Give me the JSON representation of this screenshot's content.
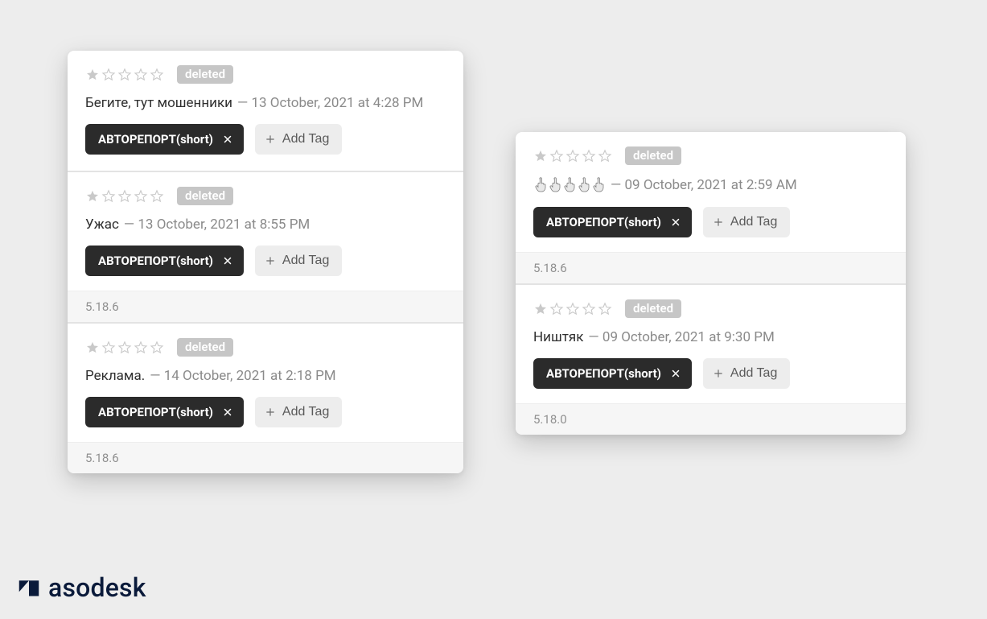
{
  "brand": {
    "name": "asodesk"
  },
  "add_tag_label": "Add Tag",
  "deleted_label": "deleted",
  "tag_label": "АВТОРЕПОРТ(short)",
  "left_panel": {
    "cards": [
      {
        "rating": 1,
        "status": "deleted",
        "title": "Бегите, тут мошенники",
        "date": "13 October, 2021 at 4:28 PM",
        "tag": "АВТОРЕПОРТ(short)",
        "version": null
      },
      {
        "rating": 1,
        "status": "deleted",
        "title": "Ужас",
        "date": "13 October, 2021 at 8:55 PM",
        "tag": "АВТОРЕПОРТ(short)",
        "version": "5.18.6"
      },
      {
        "rating": 1,
        "status": "deleted",
        "title": "Реклама.",
        "date": "14 October, 2021 at 2:18 PM",
        "tag": "АВТОРЕПОРТ(short)",
        "version": "5.18.6"
      }
    ]
  },
  "right_panel": {
    "cards": [
      {
        "rating": 1,
        "status": "deleted",
        "title_emoji_count": 5,
        "date": "09 October, 2021 at 2:59 AM",
        "tag": "АВТОРЕПОРТ(short)",
        "version": "5.18.6"
      },
      {
        "rating": 1,
        "status": "deleted",
        "title": "Ништяк",
        "date": "09 October, 2021 at 9:30 PM",
        "tag": "АВТОРЕПОРТ(short)",
        "version": "5.18.0"
      }
    ]
  }
}
